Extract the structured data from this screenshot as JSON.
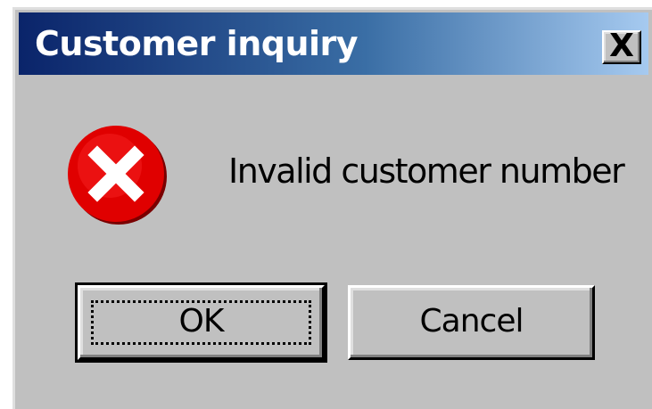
{
  "window": {
    "title": "Customer inquiry",
    "close_label": "X"
  },
  "message": {
    "text": "Invalid customer number",
    "icon": "error-icon"
  },
  "buttons": {
    "ok_label": "OK",
    "cancel_label": "Cancel"
  },
  "colors": {
    "titlebar_start": "#0a246a",
    "titlebar_end": "#a6caf0",
    "dialog_face": "#c0c0c0",
    "error_red": "#e00000"
  }
}
